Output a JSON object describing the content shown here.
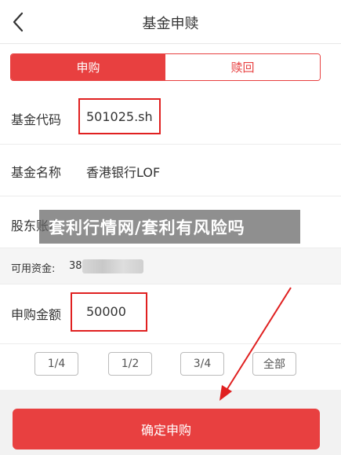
{
  "header": {
    "title": "基金申赎"
  },
  "tabs": [
    {
      "label": "申购",
      "active": true
    },
    {
      "label": "赎回",
      "active": false
    }
  ],
  "fund_code": {
    "label": "基金代码",
    "value": "501025.sh"
  },
  "fund_name": {
    "label": "基金名称",
    "value": "香港银行LOF"
  },
  "account": {
    "label": "股东账户"
  },
  "watermark": {
    "text": "套利行情网/套利有风险吗"
  },
  "available_funds": {
    "label": "可用资金:",
    "value": "38"
  },
  "purchase_amount": {
    "label": "申购金额",
    "value": "50000"
  },
  "quick_amounts": [
    "1/4",
    "1/2",
    "3/4",
    "全部"
  ],
  "confirm_button": {
    "label": "确定申购"
  },
  "colors": {
    "accent": "#e84040",
    "highlight": "#e02020"
  },
  "icons": {
    "back": "chevron-left-icon"
  }
}
